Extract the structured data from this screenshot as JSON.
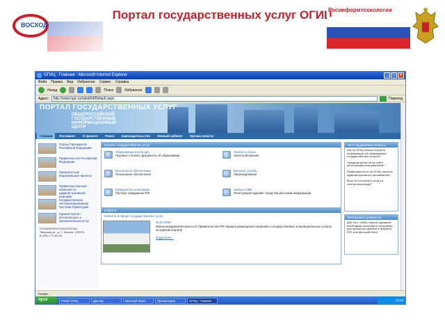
{
  "slide": {
    "title": "Портал государственных услуг ОГИЦ",
    "logo_text": "ВОСХОД",
    "brand": "Росинформтехнологии"
  },
  "browser": {
    "window_title": "ОГИЦ : Главная - Microsoft Internet Explorer",
    "menu": [
      "Файл",
      "Правка",
      "Вид",
      "Избранное",
      "Сервис",
      "Справка"
    ],
    "toolbar": {
      "back": "Назад",
      "search": "Поиск",
      "favorites": "Избранное"
    },
    "address_label": "Адрес:",
    "address": "http://www.ogic.ru/tabid/64/Default.aspx",
    "go_label": "Переход"
  },
  "portal": {
    "banner_title": "ПОРТАЛ ГОСУДАРСТВЕННЫХ УСЛУГ",
    "banner_subtitle": "ОБЩЕРОССИЙСКИЙ ГОСУДАРСТВЕННЫЙ ИНФОРМАЦИОННЫЙ ЦЕНТР",
    "nav": [
      "Главная",
      "Регламент",
      "О проекте",
      "Поиск",
      "Законодательство",
      "Личный кабинет",
      "Органы власти"
    ],
    "left_items": [
      "Портал Президента Российской Федерации",
      "Правительство Российской Федерации",
      "Приоритетные национальные проекты",
      "Правительственная комиссия по административной реформе",
      "Государственная Автоматизированная Система Правосудие",
      "Единый портал региональных и муниципальных услуг"
    ],
    "contact": [
      "РОСИНФОРМТЕХНОЛОГИИ",
      "Тверская ул., д. 7, Москва, 125375",
      "8 (495) 771-80-00"
    ],
    "catalog_header": "Каталог государственных услуг",
    "categories": [
      {
        "head": "Образование и культура",
        "body": "Научные степени. Документы об образовании"
      },
      {
        "head": "Налоги и сборы",
        "body": "Налогообложение"
      },
      {
        "head": "Пенсионное обеспечение",
        "body": "Пенсионное обеспечение"
      },
      {
        "head": "Военная служба",
        "body": "Лицензирование"
      },
      {
        "head": "Гражданство и миграция",
        "body": "Паспорт гражданина РФ"
      },
      {
        "head": "Связь и СМИ",
        "body": "Регистрация изданий. Средства массовой информации"
      },
      {
        "head": "Земельные отношения",
        "body": "Учет земельных участков"
      },
      {
        "head": "Транспорт",
        "body": "Автотранспорт. ГИБДД"
      },
      {
        "head": "Юридические лица",
        "body": "Регистрация юридических лиц"
      },
      {
        "head": "Семья и дети",
        "body": "Регистрация актов гражданского состояния"
      }
    ],
    "faq_header": "Часто задаваемые вопросы",
    "faq": [
      "Как на ОГИЦ можно получить информацию об оказываемых государственных услугах?",
      "Предусмотрена ли на сайте регистрация пользователей?",
      "Размещаются ли на ОГИЦ проекты административных регламентов?",
      "Могу ли я получить услугу в электронном виде?"
    ],
    "poll_header": "Электронные документы",
    "poll_text": "Для того, чтобы открыть документ, необходимо установить программу для просмотра файлов в формате PDF или Microsoft Word.",
    "news_header": "Новости",
    "news_sub": "Новости в сфере государственных услуг",
    "news_date": "25.03.2009",
    "news_text": "Минэкономразвития внесло в Правительство РФ порядок размещения сведений о государственных и муниципальных услугах на едином портале",
    "news_more": "Подробнее..."
  },
  "status": {
    "text": "Готово",
    "start": "пуск",
    "tasks": [
      "Portal ОГИЦ",
      "Доклад",
      "Microsoft Word",
      "Презентация",
      "ОГИЦ : Главная"
    ],
    "clock": "12:43"
  }
}
